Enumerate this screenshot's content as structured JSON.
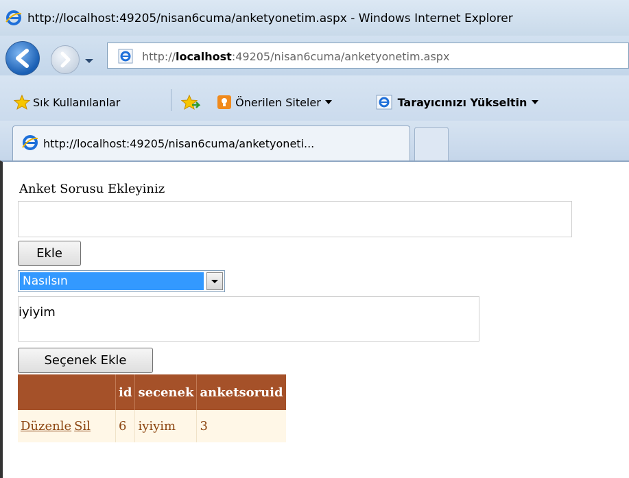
{
  "window": {
    "title": "http://localhost:49205/nisan6cuma/anketyonetim.aspx - Windows Internet Explorer"
  },
  "address_bar": {
    "url_prefix": "http://",
    "url_host": "localhost",
    "url_rest": ":49205/nisan6cuma/anketyonetim.aspx"
  },
  "favorites_bar": {
    "favorites": "Sık Kullanılanlar",
    "suggested_sites": "Önerilen Siteler",
    "upgrade_browser": "Tarayıcınızı Yükseltin"
  },
  "tab": {
    "title": "http://localhost:49205/nisan6cuma/anketyoneti..."
  },
  "form": {
    "question_label": "Anket Sorusu Ekleyiniz",
    "question_value": "",
    "add_button": "Ekle",
    "selected_question": "Nasılsın",
    "option_value": "iyiyim",
    "add_option_button": "Seçenek Ekle"
  },
  "grid": {
    "headers": [
      "",
      "id",
      "secenek",
      "anketsoruid"
    ],
    "rows": [
      {
        "edit": "Düzenle",
        "delete": "Sil",
        "id": "6",
        "secenek": "iyiyim",
        "anketsoruid": "3"
      }
    ]
  },
  "colors": {
    "grid_header": "#a55129",
    "grid_row": "#fff7e7",
    "selection": "#3399ff"
  }
}
